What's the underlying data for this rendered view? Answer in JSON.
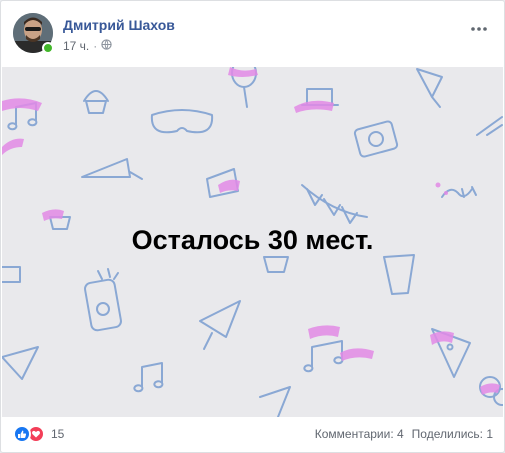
{
  "post": {
    "author": "Дмитрий Шахов",
    "time": "17 ч.",
    "separator": "·",
    "privacy_icon": "globe-icon",
    "more_icon": "more-dots-icon",
    "caption": "Осталось 30 мест.",
    "reactions": {
      "count": "15",
      "icons": [
        "like-icon",
        "love-icon"
      ]
    },
    "comments": "Комментарии: 4",
    "shares": "Поделились: 1"
  },
  "colors": {
    "author": "#385898",
    "muted": "#616770",
    "image_bg": "#e9e9ec",
    "doodle_blue": "#8aa8d4",
    "doodle_pink": "#e28ae6",
    "like": "#1877f2",
    "love": "#f33e58",
    "online": "#42b72a"
  }
}
